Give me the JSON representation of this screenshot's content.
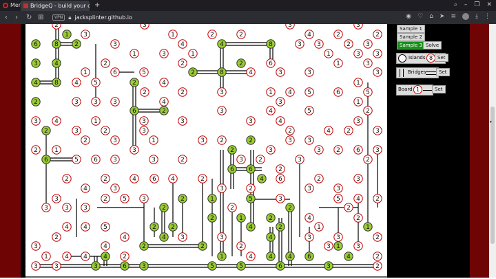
{
  "browser": {
    "menu_label": "Menu",
    "tab_title": "BridgeQ - build your own ...",
    "url_host": "jacksplinter.github.io",
    "vpn": "VPN"
  },
  "sidebar": {
    "sample1": "Sample 1",
    "sample2": "Sample 2",
    "sample3": "Sample 3",
    "solve": "Solve",
    "islands_label": "Islands",
    "islands_num": "8",
    "set": "Set",
    "bridges_label": "Bridges",
    "board_label": "Board",
    "board_num": "1"
  },
  "colors": {
    "solved_fill": "#9acd32",
    "unsolved_fill": "#ffffff",
    "unsolved_stroke": "#c00000",
    "solved_stroke": "#333333",
    "bridge": "#000000",
    "selected_button": "#1a8f1a"
  },
  "grid": {
    "cols": [
      "52",
      "67",
      "82",
      "97",
      "111",
      "124",
      "139",
      "153",
      "167",
      "181",
      "195",
      "209",
      "223",
      "237",
      "251",
      "265",
      "280",
      "294",
      "308",
      "322",
      "336",
      "350",
      "364",
      "378",
      "393",
      "407",
      "421",
      "435",
      "449",
      "463",
      "477",
      "491",
      "506",
      "520",
      "534",
      "548"
    ]
  },
  "bridges_double": [
    [
      "83,64",
      "111,64"
    ],
    [
      "321,64",
      "394,64"
    ],
    [
      "281,105",
      "366,105"
    ],
    [
      "53,120",
      "83,120"
    ],
    [
      "195,161",
      "238,161"
    ],
    [
      "68,232",
      "110,232"
    ],
    [
      "338,246",
      "380,246"
    ],
    [
      "210,358",
      "294,358"
    ],
    [
      "54,387",
      "547,387"
    ],
    [
      "83,36",
      "83,120"
    ],
    [
      "322,64",
      "322,134"
    ],
    [
      "195,120",
      "195,218"
    ],
    [
      "394,64",
      "394,92"
    ],
    [
      "237,302",
      "237,345"
    ],
    [
      "322,218",
      "322,373"
    ],
    [
      "394,330",
      "394,373"
    ],
    [
      "407,317",
      "407,387"
    ],
    [
      "421,302",
      "421,387"
    ],
    [
      "337,218",
      "337,275"
    ],
    [
      "366,218",
      "366,330"
    ],
    [
      "139,373",
      "139,387"
    ],
    [
      "153,373",
      "153,387"
    ]
  ],
  "bridges_single": [
    [
      "67,190",
      "67,232"
    ],
    [
      "67,232",
      "67,302"
    ],
    [
      "139,64",
      "139,148"
    ],
    [
      "167,105",
      "195,105"
    ],
    [
      "209,289",
      "209,358"
    ],
    [
      "224,302",
      "224,345"
    ],
    [
      "251,260",
      "251,345"
    ],
    [
      "265,289",
      "265,345"
    ],
    [
      "294,260",
      "294,358"
    ],
    [
      "308,260",
      "308,373"
    ],
    [
      "337,302",
      "337,373"
    ],
    [
      "350,317",
      "350,373"
    ],
    [
      "364,290",
      "421,290"
    ],
    [
      "449,330",
      "449,373"
    ],
    [
      "463,302",
      "520,302"
    ],
    [
      "491,302",
      "491,358"
    ],
    [
      "534,120",
      "534,330"
    ],
    [
      "548,218",
      "548,302"
    ],
    [
      "520,290",
      "520,358"
    ],
    [
      "435,232",
      "435,345"
    ],
    [
      "141,302",
      "209,302"
    ],
    [
      "111,289",
      "111,345"
    ],
    [
      "97,373",
      "153,373"
    ]
  ],
  "islands": [
    [
      "82,36,2,0"
    ],
    [
      "97,50,1,1"
    ],
    [
      "124,50,3,0"
    ],
    [
      "210,36,3,0"
    ],
    [
      "251,50,1,0"
    ],
    [
      "308,50,2,0"
    ],
    [
      "350,50,2,0"
    ],
    [
      "421,36,3,0"
    ],
    [
      "449,50,4,0"
    ],
    [
      "491,50,2,0"
    ],
    [
      "520,36,3,0"
    ],
    [
      "548,50,2,0"
    ],
    [
      "52,64,6,1"
    ],
    [
      "82,64,8,1"
    ],
    [
      "111,64,2,1"
    ],
    [
      "167,64,3,0"
    ],
    [
      "265,64,4,0"
    ],
    [
      "322,64,4,1"
    ],
    [
      "393,64,8,1"
    ],
    [
      "435,64,3,0"
    ],
    [
      "463,64,3,0"
    ],
    [
      "506,64,2,0"
    ],
    [
      "534,64,3,0"
    ],
    [
      "52,92,3,1"
    ],
    [
      "82,92,4,1"
    ],
    [
      "153,92,2,0"
    ],
    [
      "195,78,1,0"
    ],
    [
      "238,78,3,0"
    ],
    [
      "280,78,1,0"
    ],
    [
      "350,92,2,1"
    ],
    [
      "393,92,6,0"
    ],
    [
      "477,78,1,0"
    ],
    [
      "520,78,3,0"
    ],
    [
      "548,78,3,0"
    ],
    [
      "124,105,1,0"
    ],
    [
      "167,105,6,0"
    ],
    [
      "209,105,5,0"
    ],
    [
      "265,92,2,0"
    ],
    [
      "280,105,2,1"
    ],
    [
      "322,105,8,1"
    ],
    [
      "364,105,4,0"
    ],
    [
      "407,105,3,0"
    ],
    [
      "449,105,3,0"
    ],
    [
      "491,92,1,0"
    ],
    [
      "534,92,3,0"
    ],
    [
      "52,120,4,1"
    ],
    [
      "82,120,8,1"
    ],
    [
      "111,120,4,0"
    ],
    [
      "139,120,5,0"
    ],
    [
      "195,120,2,1"
    ],
    [
      "238,120,4,0"
    ],
    [
      "520,120,1,0"
    ],
    [
      "548,105,3,0"
    ],
    [
      "210,134,2,0"
    ],
    [
      "265,134,2,0"
    ],
    [
      "322,134,3,0"
    ],
    [
      "393,134,1,0"
    ],
    [
      "421,134,4,0"
    ],
    [
      "449,134,5,0"
    ],
    [
      "491,134,6,0"
    ],
    [
      "534,134,5,0"
    ],
    [
      "52,148,2,1"
    ],
    [
      "111,148,3,0"
    ],
    [
      "139,148,3,0"
    ],
    [
      "167,148,3,0"
    ],
    [
      "238,148,4,0"
    ],
    [
      "407,148,3,0"
    ],
    [
      "520,148,1,0"
    ],
    [
      "195,161,6,1"
    ],
    [
      "238,161,2,1"
    ],
    [
      "322,161,3,0"
    ],
    [
      "393,161,4,0"
    ],
    [
      "449,161,5,0"
    ],
    [
      "534,161,2,0"
    ],
    [
      "52,176,3,0"
    ],
    [
      "82,176,4,0"
    ],
    [
      "139,176,1,0"
    ],
    [
      "209,176,3,0"
    ],
    [
      "265,176,3,0"
    ],
    [
      "364,176,3,0"
    ],
    [
      "407,176,4,0"
    ],
    [
      "520,176,3,0"
    ],
    [
      "67,190,2,1"
    ],
    [
      "111,190,3,0"
    ],
    [
      "153,190,2,0"
    ],
    [
      "209,190,3,0"
    ],
    [
      "421,190,2,0"
    ],
    [
      "477,190,4,0"
    ],
    [
      "506,190,2,0"
    ],
    [
      "548,190,3,0"
    ],
    [
      "124,204,2,0"
    ],
    [
      "167,204,3,0"
    ],
    [
      "223,204,1,0"
    ],
    [
      "294,204,3,0"
    ],
    [
      "322,204,2,0"
    ],
    [
      "364,204,2,1"
    ],
    [
      "421,204,3,0"
    ],
    [
      "449,204,3,0"
    ],
    [
      "52,218,2,0"
    ],
    [
      "82,218,1,0"
    ],
    [
      "195,218,3,0"
    ],
    [
      "337,218,2,1"
    ],
    [
      "393,218,3,0"
    ],
    [
      "463,218,3,0"
    ],
    [
      "491,218,2,0"
    ],
    [
      "520,218,6,0"
    ],
    [
      "548,218,3,0"
    ],
    [
      "67,232,6,1"
    ],
    [
      "111,232,5,0"
    ],
    [
      "139,232,6,0"
    ],
    [
      "167,232,3,0"
    ],
    [
      "223,232,3,0"
    ],
    [
      "265,232,2,0"
    ],
    [
      "350,232,3,0"
    ],
    [
      "378,232,2,0"
    ],
    [
      "435,232,3,0"
    ],
    [
      "534,232,2,0"
    ],
    [
      "337,246,6,1"
    ],
    [
      "364,246,6,1"
    ],
    [
      "407,246,2,0"
    ],
    [
      "97,260,2,0"
    ],
    [
      "153,260,2,0"
    ],
    [
      "195,260,4,0"
    ],
    [
      "224,260,6,0"
    ],
    [
      "251,260,4,0"
    ],
    [
      "294,260,2,0"
    ],
    [
      "380,260,4,1"
    ],
    [
      "407,260,6,0"
    ],
    [
      "463,260,2,0"
    ],
    [
      "520,260,3,0"
    ],
    [
      "124,274,4,0"
    ],
    [
      "167,274,3,0"
    ],
    [
      "322,274,3,0"
    ],
    [
      "364,274,2,0"
    ],
    [
      "449,274,3,0"
    ],
    [
      "491,274,3,0"
    ],
    [
      "82,289,3,0"
    ],
    [
      "153,289,2,0"
    ],
    [
      "181,289,5,0"
    ],
    [
      "209,289,3,0"
    ],
    [
      "265,289,2,1"
    ],
    [
      "308,289,1,1"
    ],
    [
      "364,289,5,1"
    ],
    [
      "407,289,3,0"
    ],
    [
      "491,289,5,0"
    ],
    [
      "520,289,4,0"
    ],
    [
      "548,289,2,0"
    ],
    [
      "67,302,3,0"
    ],
    [
      "97,302,3,0"
    ],
    [
      "124,302,3,0"
    ],
    [
      "238,302,2,1"
    ],
    [
      "337,302,2,0"
    ],
    [
      "421,302,2,1"
    ],
    [
      "506,302,2,0"
    ],
    [
      "308,317,2,1"
    ],
    [
      "350,317,1,1"
    ],
    [
      "393,317,2,1"
    ],
    [
      "449,317,4,0"
    ],
    [
      "520,317,2,0"
    ],
    [
      "97,330,4,0"
    ],
    [
      "124,330,4,0"
    ],
    [
      "153,330,5,0"
    ],
    [
      "224,330,2,1"
    ],
    [
      "251,330,2,1"
    ],
    [
      "364,330,4,1"
    ],
    [
      "407,330,2,1"
    ],
    [
      "463,330,1,0"
    ],
    [
      "534,330,1,1"
    ],
    [
      "82,345,2,0"
    ],
    [
      "181,345,4,0"
    ],
    [
      "238,345,4,1"
    ],
    [
      "265,345,3,0"
    ],
    [
      "322,345,3,0"
    ],
    [
      "393,345,4,1"
    ],
    [
      "449,345,3,0"
    ],
    [
      "491,345,3,0"
    ],
    [
      "548,345,2,0"
    ],
    [
      "52,358,3,0"
    ],
    [
      "153,358,4,0"
    ],
    [
      "209,358,2,1"
    ],
    [
      "294,358,2,1"
    ],
    [
      "350,358,2,0"
    ],
    [
      "477,358,3,0"
    ],
    [
      "491,358,1,1"
    ],
    [
      "520,358,3,0"
    ],
    [
      "67,373,1,0"
    ],
    [
      "97,373,4,0"
    ],
    [
      "124,373,4,0"
    ],
    [
      "153,373,4,1"
    ],
    [
      "181,373,2,0"
    ],
    [
      "322,373,1,1"
    ],
    [
      "364,373,4,0"
    ],
    [
      "393,373,4,1"
    ],
    [
      "421,373,4,1"
    ],
    [
      "449,373,6,1"
    ],
    [
      "506,373,4,1"
    ],
    [
      "548,373,2,0"
    ],
    [
      "52,387,3,0"
    ],
    [
      "82,387,3,0"
    ],
    [
      "139,387,3,1"
    ],
    [
      "181,387,6,1"
    ],
    [
      "209,387,3,1"
    ],
    [
      "308,387,5,1"
    ],
    [
      "350,387,5,1"
    ],
    [
      "407,387,6,1"
    ],
    [
      "477,387,3,1"
    ],
    [
      "548,387,2,0"
    ]
  ]
}
